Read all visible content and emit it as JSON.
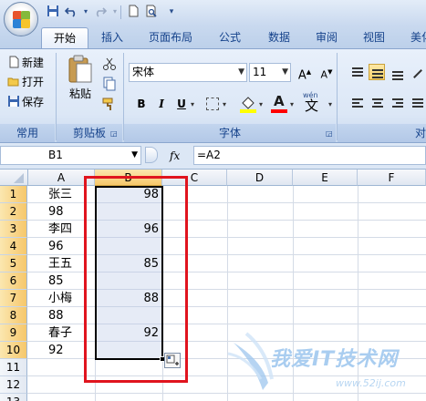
{
  "quick_access": {
    "icons": [
      "save-icon",
      "undo-icon",
      "redo-icon",
      "new-doc-icon",
      "print-preview-icon",
      "customize-icon"
    ]
  },
  "tabs": [
    {
      "label": "开始",
      "active": true
    },
    {
      "label": "插入"
    },
    {
      "label": "页面布局"
    },
    {
      "label": "公式"
    },
    {
      "label": "数据"
    },
    {
      "label": "审阅"
    },
    {
      "label": "视图"
    },
    {
      "label": "美化"
    }
  ],
  "ribbon": {
    "common": {
      "new": "新建",
      "open": "打开",
      "save": "保存",
      "label": "常用"
    },
    "clipboard": {
      "paste": "粘贴",
      "label": "剪贴板"
    },
    "font": {
      "name": "宋体",
      "size": "11",
      "bold": "B",
      "italic": "I",
      "underline": "U",
      "font_color_glyph": "A",
      "phonetic_top": "wén",
      "phonetic_glyph": "文",
      "label": "字体",
      "fill_color": "#ffff00",
      "font_color": "#ff0000"
    },
    "alignment": {
      "label": "对"
    }
  },
  "formula_bar": {
    "name_box": "B1",
    "fx": "fx",
    "formula": "=A2"
  },
  "grid": {
    "columns": [
      "A",
      "B",
      "C",
      "D",
      "E",
      "F"
    ],
    "rows": [
      "1",
      "2",
      "3",
      "4",
      "5",
      "6",
      "7",
      "8",
      "9",
      "10",
      "11",
      "12",
      "13"
    ],
    "col_a": [
      "张三",
      "98",
      "李四",
      "96",
      "王五",
      "85",
      "小梅",
      "88",
      "春子",
      "92",
      "",
      "",
      ""
    ],
    "col_b": [
      "98",
      "",
      "96",
      "",
      "85",
      "",
      "88",
      "",
      "92",
      "",
      "",
      "",
      ""
    ]
  },
  "watermark": {
    "title": "我爱IT技术网",
    "url": "www.52ij.com"
  },
  "colors": {
    "selection_border": "#000000",
    "highlight_box": "#e0141e",
    "accent": "#15428b"
  }
}
